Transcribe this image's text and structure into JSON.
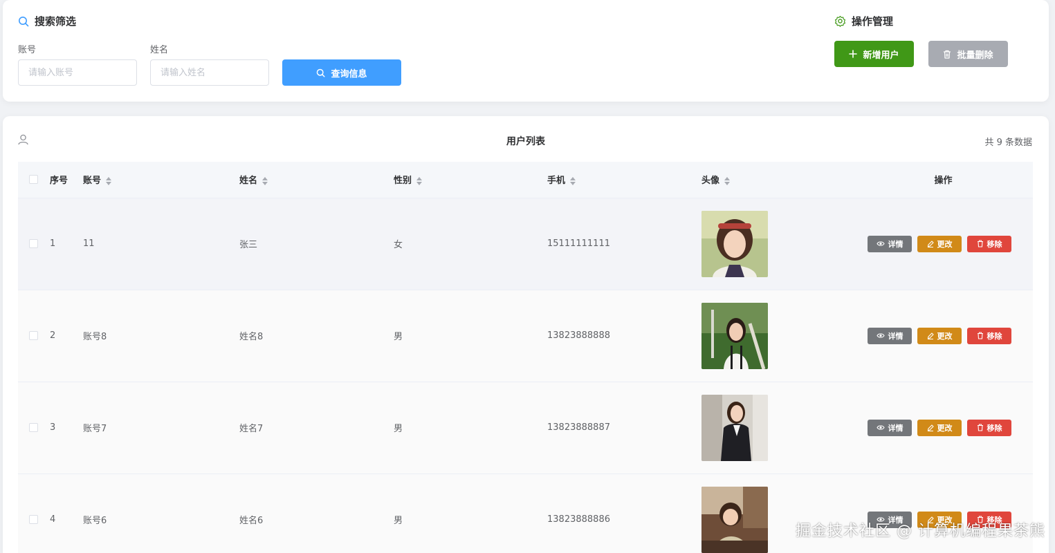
{
  "search": {
    "title": "搜索筛选",
    "account_label": "账号",
    "account_placeholder": "请输入账号",
    "name_label": "姓名",
    "name_placeholder": "请输入姓名",
    "query_button": "查询信息"
  },
  "ops_panel": {
    "title": "操作管理",
    "add_button": "新增用户",
    "batch_delete_button": "批量删除"
  },
  "list": {
    "title": "用户列表",
    "count_text": "共 9 条数据",
    "columns": [
      "序号",
      "账号",
      "姓名",
      "性别",
      "手机",
      "头像",
      "操作"
    ],
    "rows": [
      {
        "index": "1",
        "account": "11",
        "name": "张三",
        "gender": "女",
        "phone": "15111111111"
      },
      {
        "index": "2",
        "account": "账号8",
        "name": "姓名8",
        "gender": "男",
        "phone": "13823888888"
      },
      {
        "index": "3",
        "account": "账号7",
        "name": "姓名7",
        "gender": "男",
        "phone": "13823888887"
      },
      {
        "index": "4",
        "account": "账号6",
        "name": "姓名6",
        "gender": "男",
        "phone": "13823888886"
      }
    ],
    "actions": {
      "detail": "详情",
      "edit": "更改",
      "remove": "移除"
    }
  },
  "colors": {
    "primary": "#409eff",
    "success": "#409817",
    "info": "#a8abb2",
    "warning": "#d18a18",
    "danger": "#e0463c"
  },
  "watermark": "掘金技术社区 @ 计算机编程果茶熊"
}
